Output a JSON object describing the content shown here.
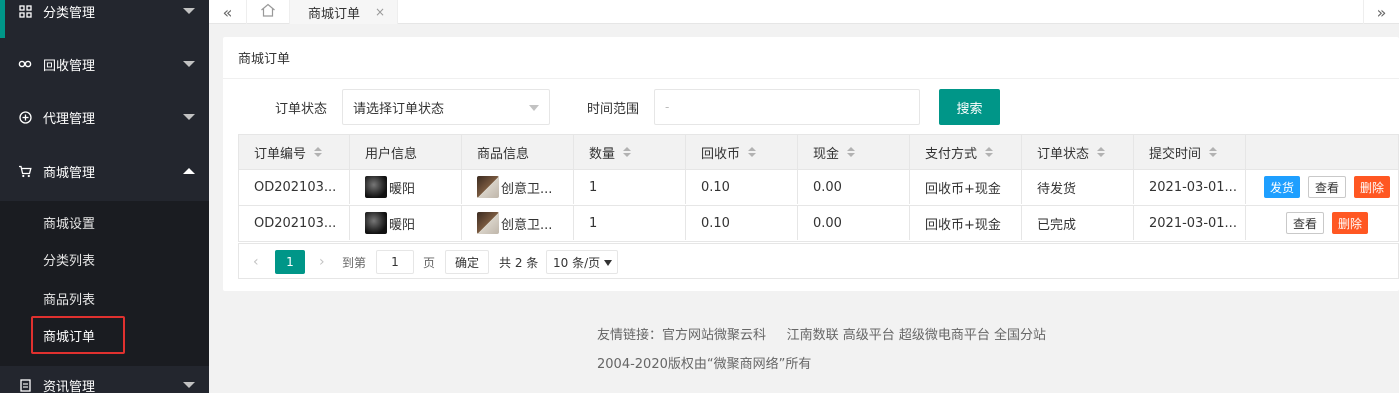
{
  "sidebar": {
    "menus": [
      {
        "label": "分类管理",
        "icon": "grid-icon",
        "expanded": false
      },
      {
        "label": "回收管理",
        "icon": "link-icon",
        "expanded": false
      },
      {
        "label": "代理管理",
        "icon": "plus-circle-icon",
        "expanded": false
      },
      {
        "label": "商城管理",
        "icon": "cart-icon",
        "expanded": true
      },
      {
        "label": "资讯管理",
        "icon": "doc-icon",
        "expanded": false
      }
    ],
    "submenu": [
      "商城设置",
      "分类列表",
      "商品列表",
      "商城订单"
    ],
    "active_submenu": "商城订单",
    "accent_color": "#009688",
    "highlight_color": "#e0312f"
  },
  "topbar": {
    "nav_left": "«",
    "nav_right": "»",
    "home_icon": "home-icon",
    "tab_label": "商城订单",
    "tab_close": "×"
  },
  "card": {
    "title": "商城订单",
    "filters": {
      "status_label": "订单状态",
      "status_value": "请选择订单状态",
      "time_label": "时间范围",
      "time_placeholder": "-",
      "search_label": "搜索"
    },
    "table": {
      "columns": [
        "订单编号",
        "用户信息",
        "商品信息",
        "数量",
        "回收币",
        "现金",
        "支付方式",
        "订单状态",
        "提交时间",
        ""
      ],
      "rows": [
        {
          "order_no": "OD202103...",
          "user": "暖阳",
          "goods": "创意卫...",
          "qty": "1",
          "coin": "0.10",
          "cash": "0.00",
          "pay": "回收币+现金",
          "status": "待发货",
          "time": "2021-03-01...",
          "actions": [
            "发货",
            "查看",
            "删除"
          ]
        },
        {
          "order_no": "OD202103...",
          "user": "暖阳",
          "goods": "创意卫...",
          "qty": "1",
          "coin": "0.10",
          "cash": "0.00",
          "pay": "回收币+现金",
          "status": "已完成",
          "time": "2021-03-01...",
          "actions": [
            "查看",
            "删除"
          ]
        }
      ]
    },
    "pagination": {
      "prev": "‹",
      "current": "1",
      "next": "›",
      "goto_label": "到第",
      "goto_value": "1",
      "page_unit": "页",
      "confirm": "确定",
      "total": "共 2 条",
      "page_size": "10 条/页"
    }
  },
  "footer": {
    "links": "友情链接：官方网站微聚云科     江南数联 高级平台 超级微电商平台 全国分站",
    "copyright": "2004-2020版权由“微聚商网络”所有"
  }
}
